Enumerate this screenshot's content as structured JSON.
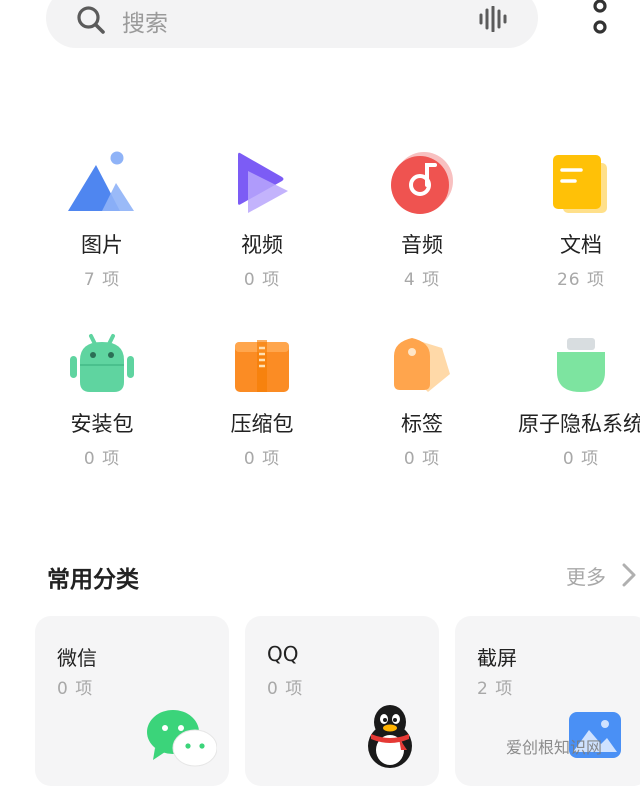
{
  "search": {
    "placeholder": "搜索"
  },
  "grid": [
    {
      "name": "图片",
      "count": "7 项"
    },
    {
      "name": "视频",
      "count": "0 项"
    },
    {
      "name": "音频",
      "count": "4 项"
    },
    {
      "name": "文档",
      "count": "26 项"
    },
    {
      "name": "安装包",
      "count": "0 项"
    },
    {
      "name": "压缩包",
      "count": "0 项"
    },
    {
      "name": "标签",
      "count": "0 项"
    },
    {
      "name": "原子隐私系统",
      "count": "0 项"
    }
  ],
  "section": {
    "title": "常用分类",
    "more": "更多"
  },
  "categories": [
    {
      "name": "微信",
      "count": "0 项"
    },
    {
      "name": "QQ",
      "count": "0 项"
    },
    {
      "name": "截屏",
      "count": "2 项"
    }
  ],
  "watermark": "爱创根知识网",
  "colors": {
    "image": "#4f86f0",
    "video": "#7c5cf5",
    "audio": "#ef5350",
    "document": "#ffc107",
    "apk": "#5fd4a0",
    "archive": "#fb8c24",
    "tag": "#ffa54d",
    "privacy": "#7de4a0"
  }
}
